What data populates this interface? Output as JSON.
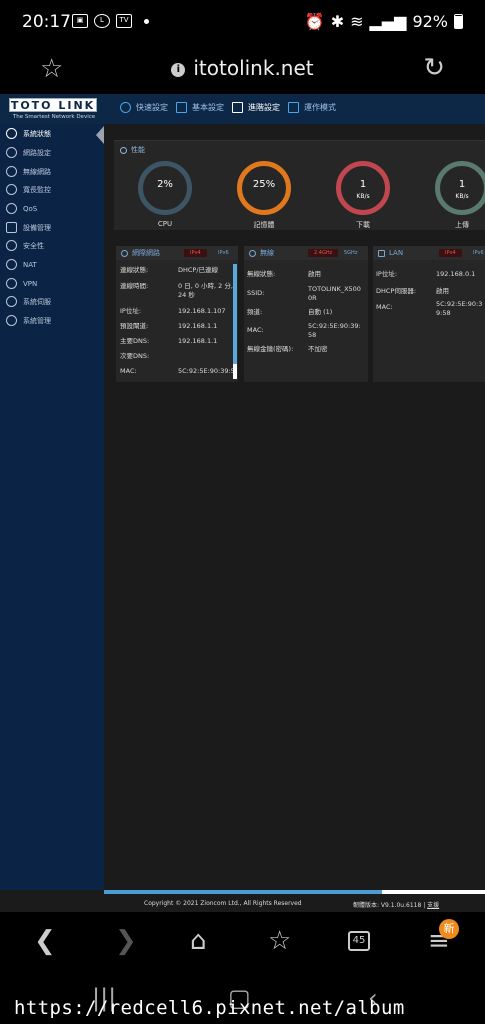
{
  "status_bar": {
    "time": "20:17",
    "battery": "92%"
  },
  "browser": {
    "url": "itotolink.net"
  },
  "router": {
    "logo": "TOTO LINK",
    "tagline": "The Smartest Network Device",
    "top_nav": [
      "快速設定",
      "基本設定",
      "進階設定",
      "運作模式"
    ],
    "sidebar": [
      "系統狀態",
      "網路設定",
      "無線網路",
      "寬長監控",
      "QoS",
      "設備管理",
      "安全性",
      "NAT",
      "VPN",
      "系統伺服",
      "系統管理"
    ],
    "performance": {
      "title": "性能",
      "gauges": [
        {
          "value": "2%",
          "unit": "",
          "label": "CPU",
          "color": "#3e5566"
        },
        {
          "value": "25%",
          "unit": "",
          "label": "記憶體",
          "color": "#e0781d"
        },
        {
          "value": "1",
          "unit": "KB/s",
          "label": "下載",
          "color": "#c0474f"
        },
        {
          "value": "1",
          "unit": "KB/s",
          "label": "上傳",
          "color": "#5a7a6e"
        }
      ]
    },
    "internet": {
      "title": "網際網路",
      "badges": [
        "IPv4",
        "IPv6"
      ],
      "rows": [
        {
          "k": "連線狀態:",
          "v": "DHCP/已連線"
        },
        {
          "k": "連線時間:",
          "v": "0 日, 0 小時, 2 分, 24 秒"
        },
        {
          "k": "IP位址:",
          "v": "192.168.1.107"
        },
        {
          "k": "預設閘道:",
          "v": "192.168.1.1"
        },
        {
          "k": "主要DNS:",
          "v": "192.168.1.1"
        },
        {
          "k": "次要DNS:",
          "v": ""
        },
        {
          "k": "MAC:",
          "v": "5C:92:5E:90:39:59"
        }
      ]
    },
    "wireless": {
      "title": "無線",
      "badges": [
        "2.4GHz",
        "5GHz"
      ],
      "rows": [
        {
          "k": "無線狀態:",
          "v": "啟用"
        },
        {
          "k": "SSID:",
          "v": "TOTOLINK_X5000R"
        },
        {
          "k": "頻道:",
          "v": "自動 (1)"
        },
        {
          "k": "MAC:",
          "v": "5C:92:5E:90:39:58"
        },
        {
          "k": "無線金鑰(密碼):",
          "v": "不加密"
        }
      ]
    },
    "lan": {
      "title": "LAN",
      "badges": [
        "IPv4",
        "IPv6"
      ],
      "rows": [
        {
          "k": "IP位址:",
          "v": "192.168.0.1"
        },
        {
          "k": "DHCP伺服器:",
          "v": "啟用"
        },
        {
          "k": "MAC:",
          "v": "5C:92:5E:90:39:58"
        }
      ]
    },
    "footer": {
      "copyright": "Copyright © 2021 Zioncom Ltd., All Rights Reserved",
      "firmware": "韌體版本: V9.1.0u.6118",
      "support": "支援"
    },
    "page_scroll_fraction": 0.73
  },
  "toolbar": {
    "tab_count": "45",
    "new_badge": "新"
  },
  "watermark": "https://redcell6.pixnet.net/album"
}
